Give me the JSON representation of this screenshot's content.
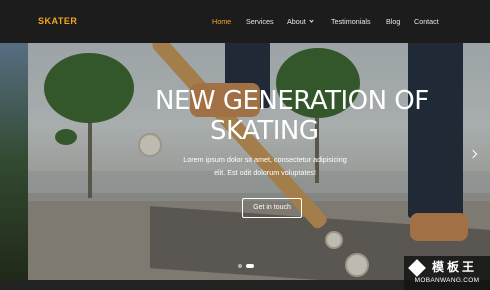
{
  "brand": {
    "logo": "SKATER",
    "accent": "#f5a623"
  },
  "nav": {
    "items": [
      {
        "label": "Home",
        "active": true
      },
      {
        "label": "Services"
      },
      {
        "label": "About",
        "dropdown": true
      },
      {
        "label": "Testimonials"
      },
      {
        "label": "Blog"
      },
      {
        "label": "Contact"
      }
    ]
  },
  "hero": {
    "title_line1": "NEW GENERATION OF",
    "title_line2": "SKATING",
    "subtitle_line1": "Lorem ipsum dolor sit amet, consectetur adipisicing",
    "subtitle_line2": "elit. Est odit dolorum voluptates!",
    "cta_label": "Get in touch",
    "next_icon": "chevron-right-icon",
    "slides_count": 2,
    "active_slide": 2
  },
  "watermark": {
    "cn": "模板王",
    "en": "MOBANWANG.COM"
  }
}
